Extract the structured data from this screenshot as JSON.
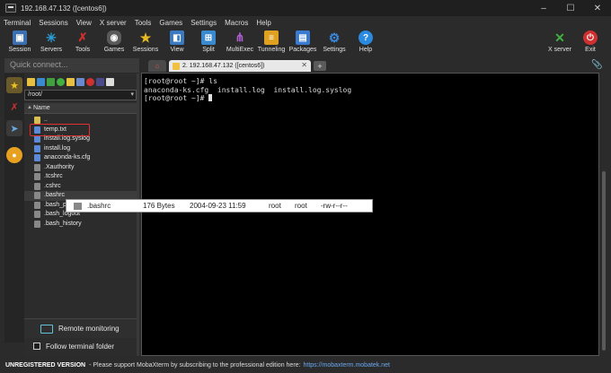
{
  "window": {
    "title": "192.168.47.132 ([centos6])",
    "controls": [
      "–",
      "☐",
      "✕"
    ]
  },
  "menu": [
    "Terminal",
    "Sessions",
    "View",
    "X server",
    "Tools",
    "Games",
    "Settings",
    "Macros",
    "Help"
  ],
  "toolbar": {
    "items": [
      {
        "label": "Session",
        "icon": "session-icon",
        "color": "#3c6fb0"
      },
      {
        "label": "Servers",
        "icon": "servers-icon",
        "color": "#2aa0d8"
      },
      {
        "label": "Tools",
        "icon": "tools-icon",
        "color": "#c03030"
      },
      {
        "label": "Games",
        "icon": "games-icon",
        "color": "#6a6a6a"
      },
      {
        "label": "Sessions",
        "icon": "star-icon",
        "color": "#e8b820"
      },
      {
        "label": "View",
        "icon": "view-icon",
        "color": "#3a7ac0"
      },
      {
        "label": "Split",
        "icon": "split-icon",
        "color": "#3a8ad0"
      },
      {
        "label": "MultiExec",
        "icon": "multiexec-icon",
        "color": "#a050c0"
      },
      {
        "label": "Tunneling",
        "icon": "tunneling-icon",
        "color": "#e0a020"
      },
      {
        "label": "Packages",
        "icon": "packages-icon",
        "color": "#3a7ad0"
      },
      {
        "label": "Settings",
        "icon": "settings-icon",
        "color": "#3a7ad0"
      },
      {
        "label": "Help",
        "icon": "help-icon",
        "color": "#2a8ae0"
      }
    ],
    "right_items": [
      {
        "label": "X server",
        "icon": "x-server-icon",
        "color": "#40a040"
      },
      {
        "label": "Exit",
        "icon": "exit-icon",
        "color": "#d03030"
      }
    ]
  },
  "quick_connect": {
    "placeholder": "Quick connect..."
  },
  "file_browser": {
    "path": "/root/",
    "column_header": "Name",
    "files": [
      {
        "name": "..",
        "icon": "folder-up-icon",
        "color": "#d8c050"
      },
      {
        "name": "temp.txt",
        "icon": "file-icon",
        "color": "#5a8ad8"
      },
      {
        "name": "install.log.syslog",
        "icon": "file-icon",
        "color": "#5a8ad8"
      },
      {
        "name": "install.log",
        "icon": "file-icon",
        "color": "#5a8ad8"
      },
      {
        "name": "anaconda-ks.cfg",
        "icon": "file-icon",
        "color": "#5a8ad8"
      },
      {
        "name": ".Xauthority",
        "icon": "file-icon",
        "color": "#888888"
      },
      {
        "name": ".tcshrc",
        "icon": "file-icon",
        "color": "#888888"
      },
      {
        "name": ".cshrc",
        "icon": "file-icon",
        "color": "#888888"
      },
      {
        "name": ".bashrc",
        "icon": "file-icon",
        "color": "#888888"
      },
      {
        "name": ".bash_profile",
        "icon": "file-icon",
        "color": "#888888"
      },
      {
        "name": ".bash_logout",
        "icon": "file-icon",
        "color": "#888888"
      },
      {
        "name": ".bash_history",
        "icon": "file-icon",
        "color": "#888888"
      }
    ],
    "remote_monitoring": "Remote monitoring",
    "follow_terminal": "Follow terminal folder"
  },
  "tabs": {
    "active": "2. 192.168.47.132 ([centos6])",
    "close": "✕",
    "new_tab": "+"
  },
  "terminal": {
    "lines": [
      "[root@root ~]# ls",
      "anaconda-ks.cfg  install.log  install.log.syslog",
      "[root@root ~]# "
    ]
  },
  "tooltip": {
    "name": ".bashrc",
    "size": "176 Bytes",
    "date": "2004-09-23 11:59",
    "owner": "root",
    "group": "root",
    "permissions": "-rw-r--r--"
  },
  "status": {
    "version": "UNREGISTERED VERSION",
    "message": " -  Please support MobaXterm by subscribing to the professional edition here:",
    "link": "https://mobaxterm.mobatek.net"
  }
}
